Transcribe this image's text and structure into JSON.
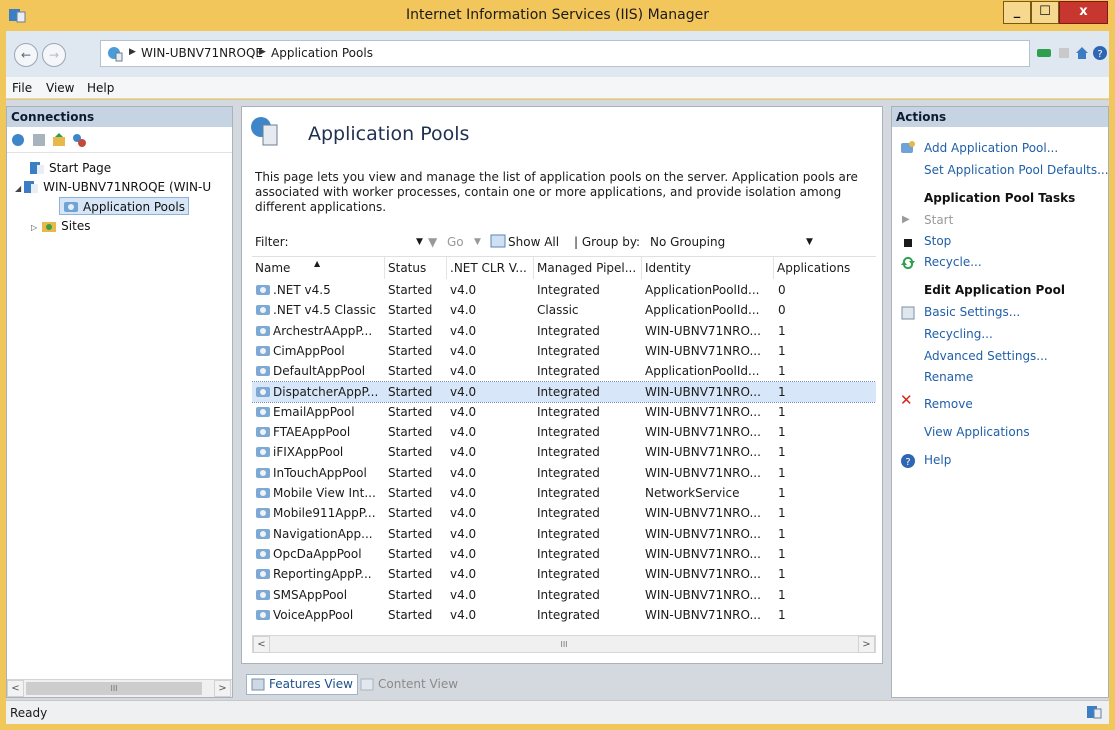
{
  "window": {
    "title": "Internet Information Services (IIS) Manager",
    "minimize": "_",
    "maximize": "☐",
    "close": "x"
  },
  "address": {
    "crumbs": [
      "WIN-UBNV71NROQE",
      "Application Pools"
    ],
    "back": "←",
    "forward": "→"
  },
  "menu": [
    "File",
    "View",
    "Help"
  ],
  "connections": {
    "header": "Connections",
    "tree": [
      {
        "label": "Start Page"
      },
      {
        "label": "WIN-UBNV71NROQE (WIN-U"
      },
      {
        "label": "Application Pools"
      },
      {
        "label": "Sites"
      }
    ],
    "scroll_thumb": "III",
    "scroll_left": "<",
    "scroll_right": ">"
  },
  "main": {
    "title": "Application Pools",
    "description": "This page lets you view and manage the list of application pools on the server. Application pools are associated with worker processes, contain one or more applications, and provide isolation among different applications.",
    "filter": {
      "label": "Filter:",
      "go": "Go",
      "show_all": "Show All",
      "group_by_label": "| Group by:",
      "group_by_value": "No Grouping"
    },
    "columns": [
      "Name",
      "Status",
      ".NET CLR V...",
      "Managed Pipel...",
      "Identity",
      "Applications"
    ],
    "rows": [
      [
        ".NET v4.5",
        "Started",
        "v4.0",
        "Integrated",
        "ApplicationPoolId...",
        "0"
      ],
      [
        ".NET v4.5 Classic",
        "Started",
        "v4.0",
        "Classic",
        "ApplicationPoolId...",
        "0"
      ],
      [
        "ArchestrAAppP...",
        "Started",
        "v4.0",
        "Integrated",
        "WIN-UBNV71NRO...",
        "1"
      ],
      [
        "CimAppPool",
        "Started",
        "v4.0",
        "Integrated",
        "WIN-UBNV71NRO...",
        "1"
      ],
      [
        "DefaultAppPool",
        "Started",
        "v4.0",
        "Integrated",
        "ApplicationPoolId...",
        "1"
      ],
      [
        "DispatcherAppP...",
        "Started",
        "v4.0",
        "Integrated",
        "WIN-UBNV71NRO...",
        "1"
      ],
      [
        "EmailAppPool",
        "Started",
        "v4.0",
        "Integrated",
        "WIN-UBNV71NRO...",
        "1"
      ],
      [
        "FTAEAppPool",
        "Started",
        "v4.0",
        "Integrated",
        "WIN-UBNV71NRO...",
        "1"
      ],
      [
        "iFIXAppPool",
        "Started",
        "v4.0",
        "Integrated",
        "WIN-UBNV71NRO...",
        "1"
      ],
      [
        "InTouchAppPool",
        "Started",
        "v4.0",
        "Integrated",
        "WIN-UBNV71NRO...",
        "1"
      ],
      [
        "Mobile View Int...",
        "Started",
        "v4.0",
        "Integrated",
        "NetworkService",
        "1"
      ],
      [
        "Mobile911AppP...",
        "Started",
        "v4.0",
        "Integrated",
        "WIN-UBNV71NRO...",
        "1"
      ],
      [
        "NavigationApp...",
        "Started",
        "v4.0",
        "Integrated",
        "WIN-UBNV71NRO...",
        "1"
      ],
      [
        "OpcDaAppPool",
        "Started",
        "v4.0",
        "Integrated",
        "WIN-UBNV71NRO...",
        "1"
      ],
      [
        "ReportingAppP...",
        "Started",
        "v4.0",
        "Integrated",
        "WIN-UBNV71NRO...",
        "1"
      ],
      [
        "SMSAppPool",
        "Started",
        "v4.0",
        "Integrated",
        "WIN-UBNV71NRO...",
        "1"
      ],
      [
        "VoiceAppPool",
        "Started",
        "v4.0",
        "Integrated",
        "WIN-UBNV71NRO...",
        "1"
      ]
    ],
    "selected_row": 5,
    "scroll_thumb": "III",
    "scroll_left": "<",
    "scroll_right": ">"
  },
  "view_tabs": {
    "features": "Features View",
    "content": "Content View"
  },
  "actions": {
    "header": "Actions",
    "add_pool": "Add Application Pool...",
    "set_defaults": "Set Application Pool Defaults...",
    "tasks_header": "Application Pool Tasks",
    "start": "Start",
    "stop": "Stop",
    "recycle": "Recycle...",
    "edit_header": "Edit Application Pool",
    "basic_settings": "Basic Settings...",
    "recycling": "Recycling...",
    "advanced_settings": "Advanced Settings...",
    "rename": "Rename",
    "remove": "Remove",
    "view_applications": "View Applications",
    "help": "Help"
  },
  "status": {
    "text": "Ready"
  }
}
